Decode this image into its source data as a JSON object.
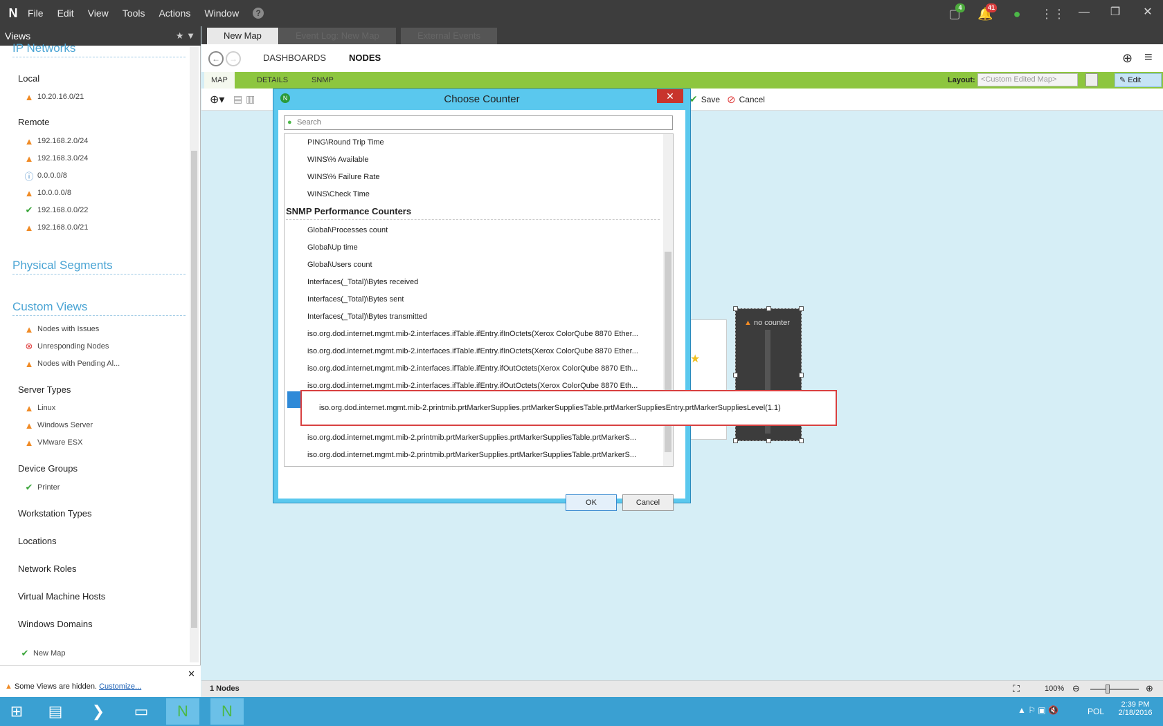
{
  "menu": [
    "File",
    "Edit",
    "View",
    "Tools",
    "Actions",
    "Window"
  ],
  "badges": {
    "tasks": "4",
    "alerts": "41"
  },
  "left": {
    "title": "Views",
    "ip_networks": "IP Networks",
    "local": "Local",
    "local_items": [
      "10.20.16.0/21"
    ],
    "remote": "Remote",
    "remote_items": [
      "192.168.2.0/24",
      "192.168.3.0/24",
      "0.0.0.0/8",
      "10.0.0.0/8",
      "192.168.0.0/22",
      "192.168.0.0/21"
    ],
    "physical": "Physical Segments",
    "custom": "Custom Views",
    "custom_items": [
      "Nodes with Issues",
      "Unresponding Nodes",
      "Nodes with Pending Al..."
    ],
    "server_types": "Server Types",
    "server_items": [
      "Linux",
      "Windows Server",
      "VMware ESX"
    ],
    "device_groups": "Device Groups",
    "device_items": [
      "Printer"
    ],
    "workstation": "Workstation Types",
    "locations": "Locations",
    "network_roles": "Network Roles",
    "vm_hosts": "Virtual Machine Hosts",
    "domains": "Windows Domains",
    "new_map": "New Map",
    "hidden_text": "Some Views are hidden.",
    "customize": "Customize..."
  },
  "tabs": [
    "New Map",
    "Event Log: New Map",
    "External Events"
  ],
  "nav": {
    "dashboards": "DASHBOARDS",
    "nodes": "NODES"
  },
  "subtabs": [
    "MAP",
    "DETAILS",
    "SNMP"
  ],
  "layout": {
    "label": "Layout:",
    "value": "<Custom Edited Map>",
    "edit": "Edit"
  },
  "toolbar": {
    "save": "Save",
    "cancel": "Cancel"
  },
  "node": {
    "label": "no counter"
  },
  "status": {
    "nodes": "1 Nodes",
    "zoom": "100%"
  },
  "dialog": {
    "title": "Choose Counter",
    "search_placeholder": "Search",
    "items_top": [
      "PING\\Round Trip Time",
      "WINS\\% Available",
      "WINS\\% Failure Rate",
      "WINS\\Check Time"
    ],
    "snmp_header": "SNMP Performance Counters",
    "items_snmp": [
      "Global\\Processes count",
      "Global\\Up time",
      "Global\\Users count",
      "Interfaces(_Total)\\Bytes received",
      "Interfaces(_Total)\\Bytes sent",
      "Interfaces(_Total)\\Bytes transmitted",
      "iso.org.dod.internet.mgmt.mib-2.interfaces.ifTable.ifEntry.ifInOctets(Xerox ColorQube 8870 Ether...",
      "iso.org.dod.internet.mgmt.mib-2.interfaces.ifTable.ifEntry.ifInOctets(Xerox ColorQube 8870 Ether...",
      "iso.org.dod.internet.mgmt.mib-2.interfaces.ifTable.ifEntry.ifOutOctets(Xerox ColorQube 8870 Eth...",
      "iso.org.dod.internet.mgmt.mib-2.interfaces.ifTable.ifEntry.ifOutOctets(Xerox ColorQube 8870 Eth..."
    ],
    "items_bottom": [
      "iso.org.dod.internet.mgmt.mib-2.printmib.prtMarkerSupplies.prtMarkerSuppliesTable.prtMarkerS...",
      "iso.org.dod.internet.mgmt.mib-2.printmib.prtMarkerSupplies.prtMarkerSuppliesTable.prtMarkerS..."
    ],
    "tooltip": "iso.org.dod.internet.mgmt.mib-2.printmib.prtMarkerSupplies.prtMarkerSuppliesTable.prtMarkerSuppliesEntry.prtMarkerSuppliesLevel(1.1)",
    "ok": "OK",
    "cancel": "Cancel"
  },
  "tray": {
    "lang": "POL",
    "time": "2:39 PM",
    "date": "2/18/2016"
  }
}
